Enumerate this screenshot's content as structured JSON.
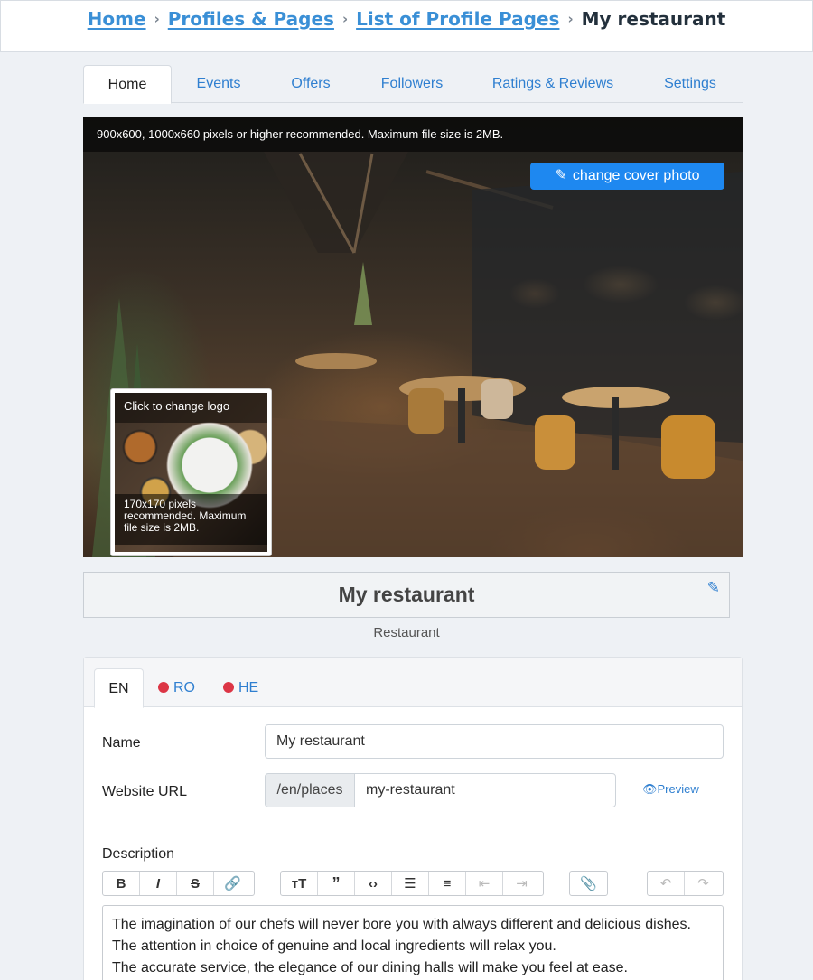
{
  "breadcrumb": {
    "items": [
      "Home",
      "Profiles & Pages",
      "List of Profile Pages"
    ],
    "current": "My restaurant"
  },
  "tabs": [
    "Home",
    "Events",
    "Offers",
    "Followers",
    "Ratings & Reviews",
    "Settings"
  ],
  "active_tab": "Home",
  "cover": {
    "note": "900x600, 1000x660 pixels or higher recommended. Maximum file size is 2MB.",
    "button_label": "change cover photo"
  },
  "logo": {
    "top_label": "Click to change logo",
    "bottom_note": "170x170 pixels recommended. Maximum file size is 2MB."
  },
  "profile": {
    "name": "My restaurant",
    "category": "Restaurant"
  },
  "languages": {
    "tabs": [
      "EN",
      "RO",
      "HE"
    ],
    "active": "EN"
  },
  "form": {
    "name_label": "Name",
    "name_value": "My restaurant",
    "url_label": "Website URL",
    "url_prefix": "/en/places",
    "url_value": "my-restaurant",
    "preview_label": "Preview",
    "description_label": "Description",
    "description_lines": [
      "The imagination of our chefs will never bore you with always different and delicious dishes.",
      "The attention in choice of genuine and local ingredients will relax you.",
      "The accurate service, the elegance of our dining halls will make you feel at ease."
    ]
  },
  "toolbar": {
    "icons": [
      "bold-icon",
      "italic-icon",
      "strikethrough-icon",
      "link-icon",
      "heading-icon",
      "quote-icon",
      "code-icon",
      "bullet-list-icon",
      "numbered-list-icon",
      "outdent-icon",
      "indent-icon",
      "attach-icon",
      "undo-icon",
      "redo-icon"
    ]
  },
  "colors": {
    "link": "#3a8fd6",
    "button": "#1e88f0",
    "language_dot": "#dc3545"
  }
}
